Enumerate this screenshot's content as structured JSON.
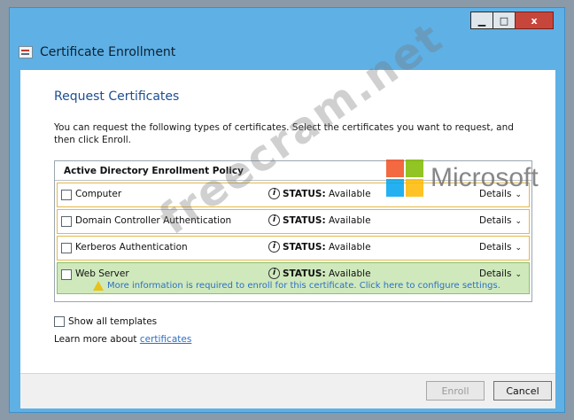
{
  "window": {
    "controls": {
      "minimize": "▁",
      "maximize": "□",
      "close": "x"
    }
  },
  "app": {
    "title": "Certificate Enrollment",
    "icon": "certificate-icon"
  },
  "page": {
    "heading": "Request Certificates",
    "intro": "You can request the following types of certificates. Select the certificates you want to request, and then click Enroll."
  },
  "policy": {
    "header": "Active Directory Enrollment Policy",
    "rows": [
      {
        "label": "Computer",
        "status_label": "STATUS:",
        "status": "Available",
        "details": "Details"
      },
      {
        "label": "Domain Controller Authentication",
        "status_label": "STATUS:",
        "status": "Available",
        "details": "Details"
      },
      {
        "label": "Kerberos Authentication",
        "status_label": "STATUS:",
        "status": "Available",
        "details": "Details"
      },
      {
        "label": "Web Server",
        "status_label": "STATUS:",
        "status": "Available",
        "details": "Details",
        "warning": "More information is required to enroll for this certificate. Click here to configure settings."
      }
    ],
    "info_glyph": "i",
    "chevron_glyph": "⌄"
  },
  "options": {
    "show_all": "Show all templates",
    "learn_prefix": "Learn more about ",
    "learn_link": "certificates"
  },
  "buttons": {
    "enroll": "Enroll",
    "cancel": "Cancel"
  },
  "overlay": {
    "brand": "Microsoft",
    "brand_colors": [
      "#f25022",
      "#7fba00",
      "#00a4ef",
      "#ffb900"
    ],
    "watermark": "freecram.net"
  }
}
